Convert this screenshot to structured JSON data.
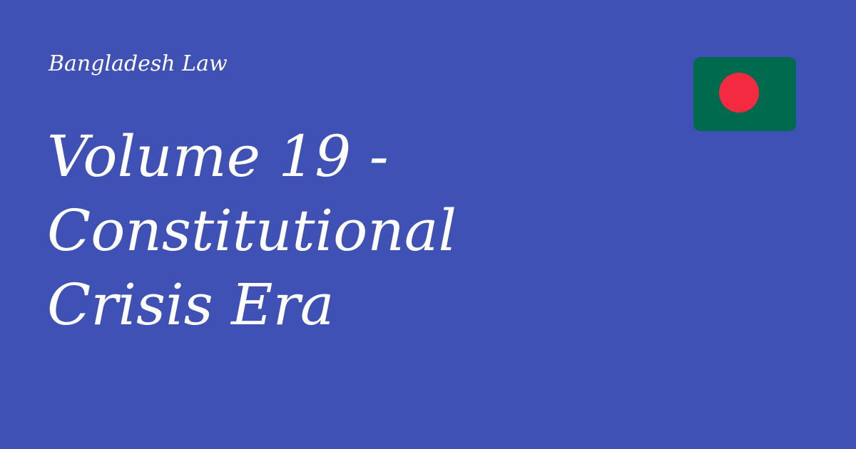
{
  "site": {
    "label": "Bangladesh Law"
  },
  "title": {
    "lines": [
      "Volume 19 -",
      "Constitutional",
      "Crisis Era"
    ]
  },
  "flag": {
    "icon": "bangladesh-flag-icon",
    "field_color": "#006a4e",
    "disc_color": "#f42a41"
  },
  "theme": {
    "background": "#3f51b5",
    "text": "#ffffff"
  }
}
